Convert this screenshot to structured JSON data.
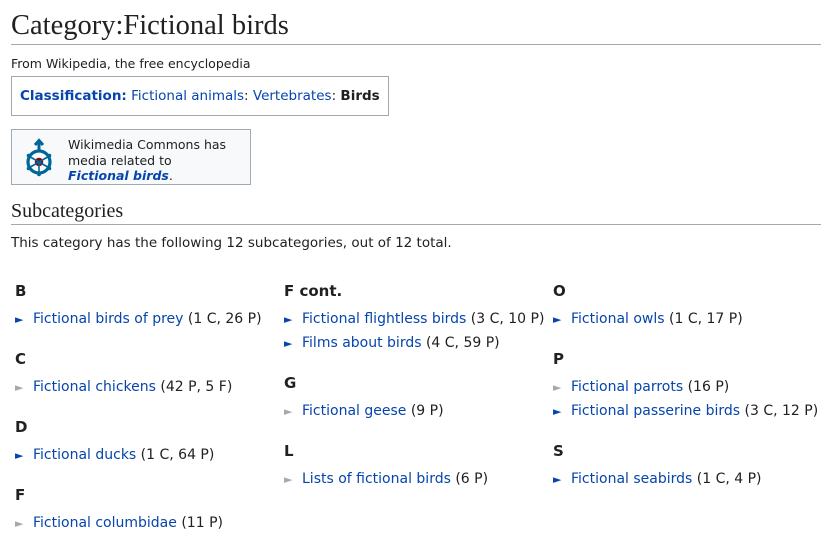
{
  "page": {
    "title": "Category:Fictional birds",
    "tagline": "From Wikipedia, the free encyclopedia"
  },
  "classification": {
    "label": "Classification:",
    "crumbs": [
      {
        "text": "Fictional animals",
        "sep": ": "
      },
      {
        "text": "Vertebrates",
        "sep": ": "
      }
    ],
    "current": "Birds"
  },
  "commons": {
    "text_line1": "Wikimedia Commons has",
    "text_line2": "media related to",
    "link": "Fictional birds",
    "suffix": "."
  },
  "subcategories": {
    "heading": "Subcategories",
    "summary": "This category has the following 12 subcategories, out of 12 total.",
    "columns": [
      {
        "groups": [
          {
            "head": "B",
            "items": [
              {
                "label": "Fictional birds of prey",
                "count": "(1 C, 26 P)",
                "expandable": true
              }
            ]
          },
          {
            "head": "C",
            "items": [
              {
                "label": "Fictional chickens",
                "count": "(42 P, 5 F)",
                "expandable": false
              }
            ]
          },
          {
            "head": "D",
            "items": [
              {
                "label": "Fictional ducks",
                "count": "(1 C, 64 P)",
                "expandable": true
              }
            ]
          },
          {
            "head": "F",
            "items": [
              {
                "label": "Fictional columbidae",
                "count": "(11 P)",
                "expandable": false
              }
            ]
          }
        ]
      },
      {
        "groups": [
          {
            "head": "F cont.",
            "items": [
              {
                "label": "Fictional flightless birds",
                "count": "(3 C, 10 P)",
                "expandable": true
              },
              {
                "label": "Films about birds",
                "count": "(4 C, 59 P)",
                "expandable": true
              }
            ]
          },
          {
            "head": "G",
            "items": [
              {
                "label": "Fictional geese",
                "count": "(9 P)",
                "expandable": false
              }
            ]
          },
          {
            "head": "L",
            "items": [
              {
                "label": "Lists of fictional birds",
                "count": "(6 P)",
                "expandable": false
              }
            ]
          }
        ]
      },
      {
        "groups": [
          {
            "head": "O",
            "items": [
              {
                "label": "Fictional owls",
                "count": "(1 C, 17 P)",
                "expandable": true
              }
            ]
          },
          {
            "head": "P",
            "items": [
              {
                "label": "Fictional parrots",
                "count": "(16 P)",
                "expandable": false
              },
              {
                "label": "Fictional passerine birds",
                "count": "(3 C, 12 P)",
                "expandable": true
              }
            ]
          },
          {
            "head": "S",
            "items": [
              {
                "label": "Fictional seabirds",
                "count": "(1 C, 4 P)",
                "expandable": true
              }
            ]
          }
        ]
      }
    ]
  },
  "icons": {
    "expand": "triangle-right-icon",
    "empty": "triangle-right-grey-icon",
    "commons": "wikimedia-commons-logo"
  },
  "colors": {
    "link": "#0645ad",
    "text": "#202122",
    "border": "#a2a9b1",
    "commons_blue": "#006699",
    "commons_red": "#990000"
  }
}
